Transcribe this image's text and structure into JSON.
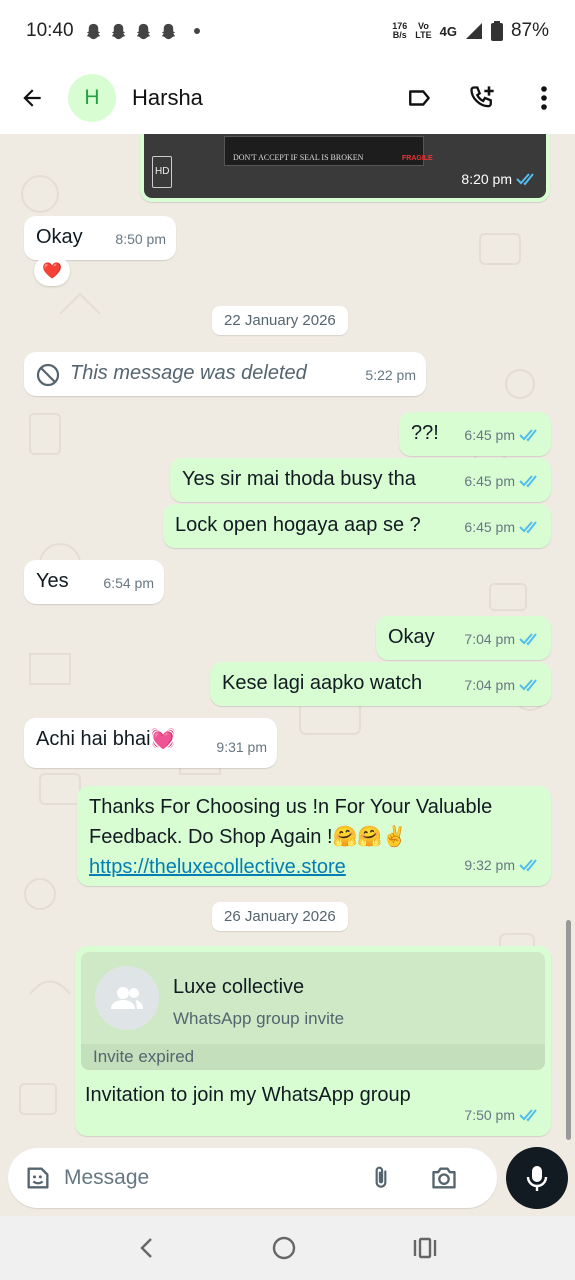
{
  "status_bar": {
    "time": "10:40",
    "net_speed_top": "176",
    "net_speed_bottom": "B/s",
    "volte_top": "Vo",
    "volte_bottom": "LTE",
    "network": "4G",
    "battery": "87%"
  },
  "header": {
    "avatar_initial": "H",
    "contact_name": "Harsha"
  },
  "messages": {
    "img_caption_seal": "DON'T ACCEPT IF SEAL IS BROKEN",
    "img_caption_fragile": "FRAGILE",
    "img_hd": "HD",
    "img_time": "8:20 pm",
    "okay_text": "Okay",
    "okay_time": "8:50 pm",
    "okay_reaction": "❤️",
    "date1": "22 January 2026",
    "deleted_text": "This message was deleted",
    "deleted_time": "5:22 pm",
    "q_text": "??!",
    "q_time": "6:45 pm",
    "busy_text": "Yes sir mai thoda busy tha",
    "busy_time": "6:45 pm",
    "lock_text": "Lock open hogaya aap se ?",
    "lock_time": "6:45 pm",
    "yes_text": "Yes",
    "yes_time": "6:54 pm",
    "okay2_text": "Okay",
    "okay2_time": "7:04 pm",
    "kese_text": "Kese lagi aapko watch",
    "kese_time": "7:04 pm",
    "achi_text": "Achi hai bhai💓",
    "achi_time": "9:31 pm",
    "thanks_line1": "Thanks For Choosing us !n For Your Valuable",
    "thanks_line2": "Feedback. Do Shop Again !🤗🤗✌️",
    "thanks_link": "https://theluxecollective.store",
    "thanks_time": "9:32 pm",
    "date2": "26 January 2026",
    "invite_group_name": "Luxe collective",
    "invite_subtitle": "WhatsApp group invite",
    "invite_expired": "Invite expired",
    "invite_text": "Invitation to join my WhatsApp group",
    "invite_time": "7:50 pm"
  },
  "composer": {
    "placeholder": "Message"
  },
  "colors": {
    "outgoing": "#d9fdd3",
    "incoming": "#ffffff",
    "read_ticks": "#53bdeb",
    "background": "#efeae2"
  }
}
